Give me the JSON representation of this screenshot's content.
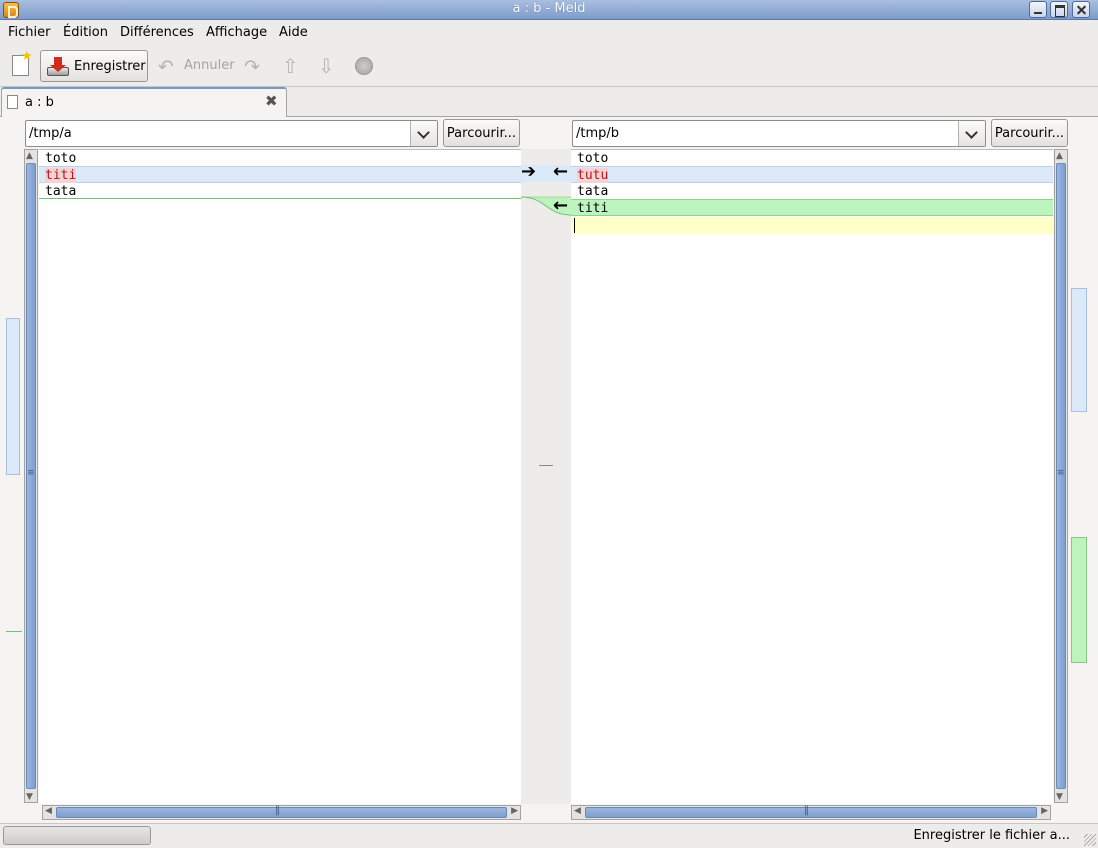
{
  "window": {
    "title": "a : b - Meld"
  },
  "menu": {
    "items": [
      "Fichier",
      "Édition",
      "Différences",
      "Affichage",
      "Aide"
    ]
  },
  "toolbar": {
    "save_label": "Enregistrer",
    "undo_label": "Annuler",
    "icons": [
      "new-document-icon",
      "save-icon",
      "undo-icon",
      "redo-icon",
      "previous-change-icon",
      "next-change-icon",
      "stop-icon"
    ]
  },
  "tab": {
    "label": "a : b"
  },
  "left_pane": {
    "path": "/tmp/a",
    "browse_label": "Parcourir...",
    "lines": [
      {
        "text": "toto",
        "state": "normal"
      },
      {
        "text": "titi",
        "state": "changed"
      },
      {
        "text": "tata",
        "state": "normal"
      }
    ]
  },
  "right_pane": {
    "path": "/tmp/b",
    "browse_label": "Parcourir...",
    "lines": [
      {
        "text": "toto",
        "state": "normal"
      },
      {
        "text": "tutu",
        "state": "changed"
      },
      {
        "text": "tata",
        "state": "normal"
      },
      {
        "text": "titi",
        "state": "inserted"
      },
      {
        "text": "",
        "state": "current"
      }
    ]
  },
  "colors": {
    "changed": "#dce9f8",
    "inserted": "#bdf4bd",
    "current_line": "#ffffc8",
    "highlight_text": "#c4101a"
  },
  "statusbar": {
    "text": "Enregistrer le fichier a..."
  }
}
